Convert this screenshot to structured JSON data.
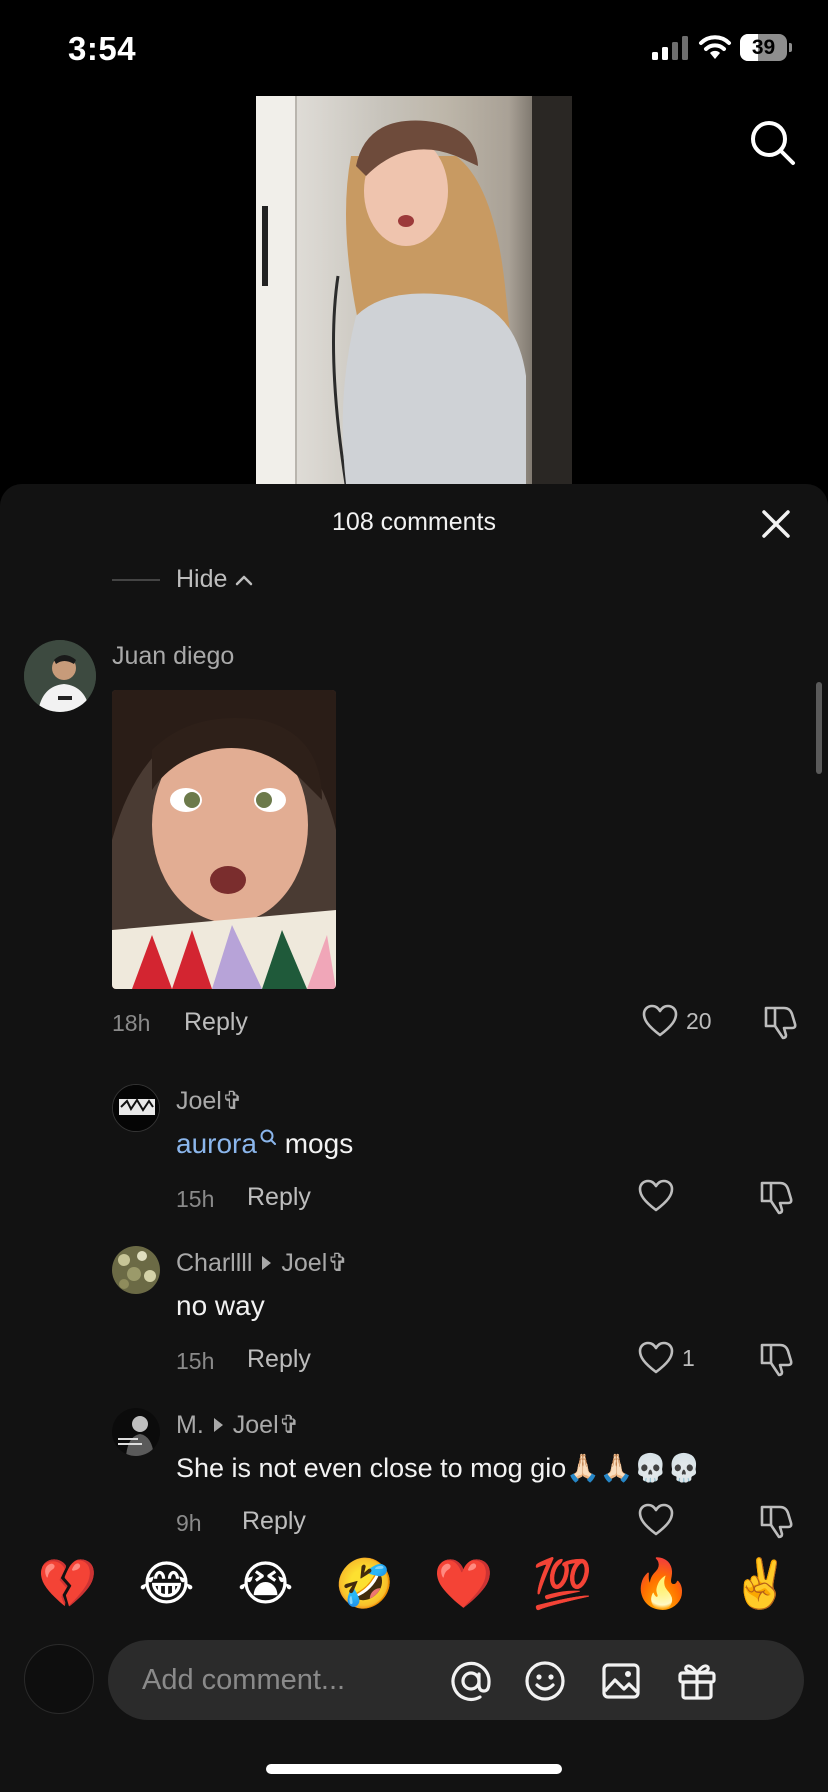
{
  "status_bar": {
    "time": "3:54",
    "battery": "39",
    "battery_level": 0.39
  },
  "sheet": {
    "title": "108 comments",
    "hide_label": "Hide"
  },
  "comments": [
    {
      "name": "Juan diego",
      "time": "18h",
      "reply_label": "Reply",
      "like_count": "20"
    },
    {
      "name": "Joel✞",
      "mention": "aurora",
      "text": "mogs",
      "time": "15h",
      "reply_label": "Reply",
      "like_count": ""
    },
    {
      "name": "Charllll",
      "reply_to": "Joel✞",
      "text": "no way",
      "time": "15h",
      "reply_label": "Reply",
      "like_count": "1"
    },
    {
      "name": "M.",
      "reply_to": "Joel✞",
      "text": "She is not even close to mog gio🙏🏻🙏🏻💀💀",
      "time": "9h",
      "reply_label": "Reply",
      "like_count": ""
    }
  ],
  "emoji_bar": [
    "💔",
    "😂",
    "😭",
    "🤣",
    "❤️",
    "💯",
    "🔥",
    "✌️"
  ],
  "composer": {
    "placeholder": "Add comment..."
  },
  "colors": {
    "background": "#000000",
    "sheet": "#121212",
    "mention": "#8bb6ec",
    "muted_text": "#a9a9a9"
  },
  "icons": [
    "signal-icon",
    "wifi-icon",
    "battery-icon",
    "search-icon",
    "close-icon",
    "chevron-up-icon",
    "heart-icon",
    "dislike-icon",
    "at-icon",
    "emoji-icon",
    "image-icon",
    "gift-icon"
  ]
}
